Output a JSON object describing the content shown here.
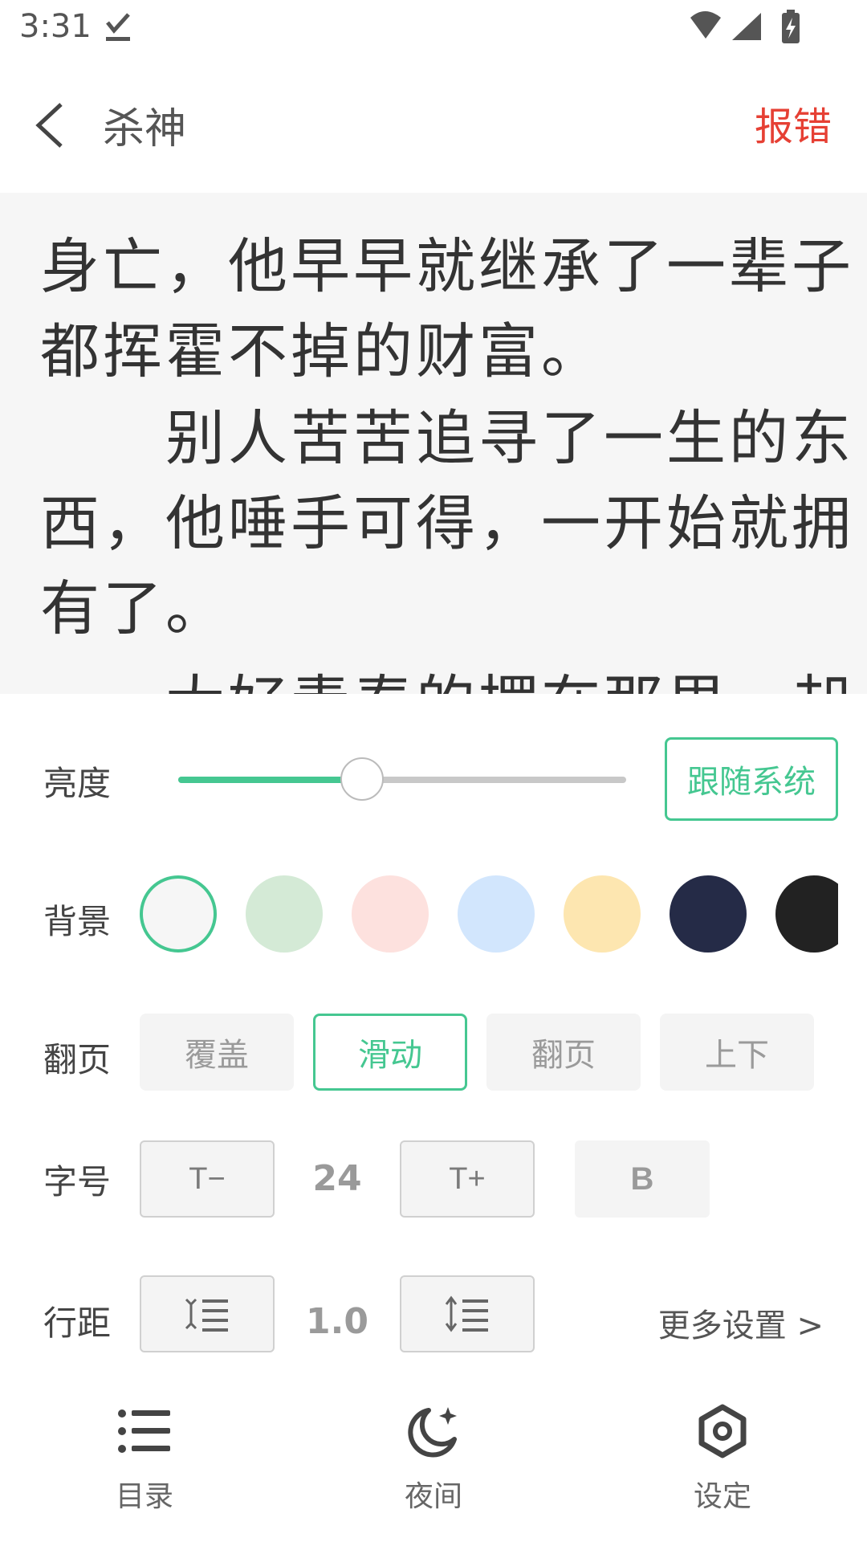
{
  "status_bar": {
    "time": "3:31"
  },
  "header": {
    "title": "杀神",
    "report_label": "报错"
  },
  "reading": {
    "lines": [
      "身亡，他早早就继承了一辈子",
      "都挥霍不掉的财富。",
      "　　别人苦苦追寻了一生的东",
      "西，他唾手可得，一开始就拥",
      "有了。",
      "　　大好青春的摆在那里，却"
    ]
  },
  "settings": {
    "brightness": {
      "label": "亮度",
      "level": 0.41,
      "follow_label": "跟随系统"
    },
    "background": {
      "label": "背景",
      "swatches": [
        "#f6f6f6",
        "#d4ead6",
        "#fde1de",
        "#d2e6fd",
        "#fde6b0",
        "#252b47",
        "#222222"
      ],
      "selected": 0
    },
    "page_turn": {
      "label": "翻页",
      "options": [
        "覆盖",
        "滑动",
        "翻页",
        "上下"
      ],
      "selected": 1
    },
    "font_size": {
      "label": "字号",
      "decrease_label": "T−",
      "value": "24",
      "increase_label": "T+",
      "bold_label": "B"
    },
    "line_spacing": {
      "label": "行距",
      "value": "1.0",
      "decrease_icon": "line-spacing-decrease-icon",
      "increase_icon": "line-spacing-increase-icon"
    },
    "more_label": "更多设置 >"
  },
  "bottom_nav": {
    "items": [
      {
        "label": "目录",
        "icon": "list-icon"
      },
      {
        "label": "夜间",
        "icon": "moon-icon"
      },
      {
        "label": "设定",
        "icon": "gear-icon"
      }
    ]
  },
  "colors": {
    "accent": "#45c791",
    "report": "#e64034"
  }
}
